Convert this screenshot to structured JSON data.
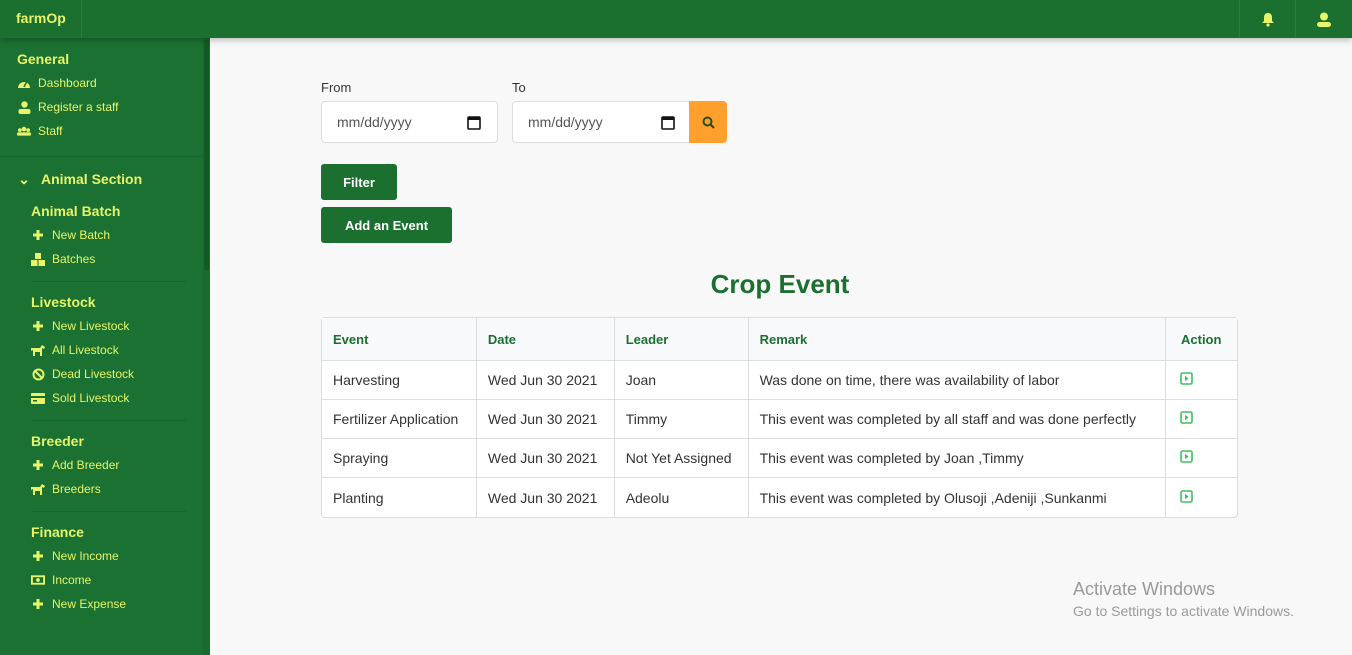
{
  "app": {
    "brand": "farmOp"
  },
  "header": {
    "icons": [
      "bell-icon",
      "user-icon"
    ]
  },
  "sidebar": {
    "general": {
      "title": "General",
      "items": [
        {
          "label": "Dashboard",
          "icon": "tachometer-icon"
        },
        {
          "label": "Register a staff",
          "icon": "user-icon"
        },
        {
          "label": "Staff",
          "icon": "users-icon"
        }
      ]
    },
    "animal_section": {
      "title": "Animal Section",
      "icon": "chevron-down-icon"
    },
    "groups": [
      {
        "title": "Animal Batch",
        "items": [
          {
            "label": "New Batch",
            "icon": "plus-icon"
          },
          {
            "label": "Batches",
            "icon": "boxes-icon"
          }
        ]
      },
      {
        "title": "Livestock",
        "items": [
          {
            "label": "New Livestock",
            "icon": "plus-icon"
          },
          {
            "label": "All Livestock",
            "icon": "horse-icon"
          },
          {
            "label": "Dead Livestock",
            "icon": "ban-icon"
          },
          {
            "label": "Sold Livestock",
            "icon": "credit-card-icon"
          }
        ]
      },
      {
        "title": "Breeder",
        "items": [
          {
            "label": "Add Breeder",
            "icon": "plus-icon"
          },
          {
            "label": "Breeders",
            "icon": "horse-icon"
          }
        ]
      },
      {
        "title": "Finance",
        "items": [
          {
            "label": "New Income",
            "icon": "plus-icon"
          },
          {
            "label": "Income",
            "icon": "money-bill-icon"
          },
          {
            "label": "New Expense",
            "icon": "plus-icon"
          }
        ]
      }
    ]
  },
  "filter": {
    "from_label": "From",
    "to_label": "To",
    "from_placeholder": "mm/dd/yyyy",
    "to_placeholder": "mm/dd/yyyy",
    "filter_button": "Filter",
    "add_button": "Add an Event"
  },
  "colors": {
    "primary": "#1b7030",
    "accent": "#ffa02e",
    "sidebar_text": "#e6f56a"
  },
  "table": {
    "title": "Crop Event",
    "columns": [
      "Event",
      "Date",
      "Leader",
      "Remark",
      "Action"
    ],
    "rows": [
      [
        "Harvesting",
        "Wed Jun 30 2021",
        "Joan",
        "Was done on time, there was availability of labor"
      ],
      [
        "Fertilizer Application",
        "Wed Jun 30 2021",
        "Timmy",
        "This event was completed by all staff and was done perfectly"
      ],
      [
        "Spraying",
        "Wed Jun 30 2021",
        "Not Yet Assigned",
        "This event was completed by Joan ,Timmy"
      ],
      [
        "Planting",
        "Wed Jun 30 2021",
        "Adeolu",
        "This event was completed by Olusoji ,Adeniji ,Sunkanmi"
      ]
    ]
  },
  "watermark": {
    "title": "Activate Windows",
    "subtitle": "Go to Settings to activate Windows."
  }
}
